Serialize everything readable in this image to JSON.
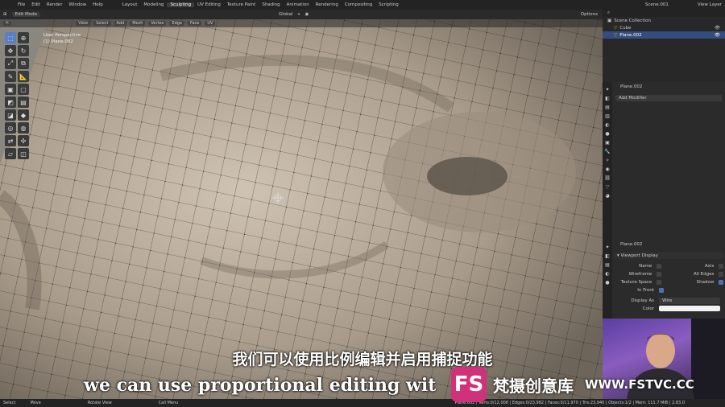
{
  "top_menu": [
    "File",
    "Edit",
    "Render",
    "Window",
    "Help"
  ],
  "workspaces": [
    "Layout",
    "Modeling",
    "Sculpting",
    "UV Editing",
    "Texture Paint",
    "Shading",
    "Animation",
    "Rendering",
    "Compositing",
    "Scripting"
  ],
  "active_workspace": "Sculpting",
  "scene": "Scene.001",
  "view_layer": "View Layer",
  "header": {
    "mode": "Edit Mode",
    "menus": [
      "View",
      "Select",
      "Add",
      "Mesh",
      "Vertex",
      "Edge",
      "Face",
      "UV"
    ],
    "orientation": "Global",
    "options": "Options"
  },
  "viewport": {
    "perspective": "User Perspective",
    "object": "(1) Plane.002"
  },
  "outliner": {
    "root": "Scene Collection",
    "items": [
      "Cube",
      "Plane.002"
    ]
  },
  "modifiers": {
    "object": "Plane.002",
    "add_modifier": "Add Modifier"
  },
  "object_props": {
    "object": "Plane.002",
    "section": "Viewport Display",
    "left": [
      {
        "label": "Name",
        "checked": false
      },
      {
        "label": "Wireframe",
        "checked": false
      },
      {
        "label": "Texture Space",
        "checked": false
      },
      {
        "label": "In Front",
        "checked": true
      }
    ],
    "right": [
      {
        "label": "Axis",
        "checked": false
      },
      {
        "label": "All Edges",
        "checked": false
      },
      {
        "label": "Shadow",
        "checked": true
      }
    ],
    "display_as_label": "Display As",
    "display_as": "Wire",
    "color_label": "Color"
  },
  "status": {
    "select": "Select",
    "move": "Move",
    "rotate": "Rotate View",
    "call_menu": "Call Menu",
    "stats": "Plane.002 | Verts:0/12,008 | Edges:0/23,982 | Faces:0/11,970 | Tris:23,940 | Objects:1/2 | Mem: 111.7 MiB | 2.83.0"
  },
  "subtitles": {
    "cn": "我们可以使用比例编辑并启用捕捉功能",
    "en": "we can use proportional editing wit"
  },
  "watermark": {
    "logo_text": "FS",
    "cn": "梵摄创意库",
    "url": "WWW.FSTVC.CC"
  }
}
